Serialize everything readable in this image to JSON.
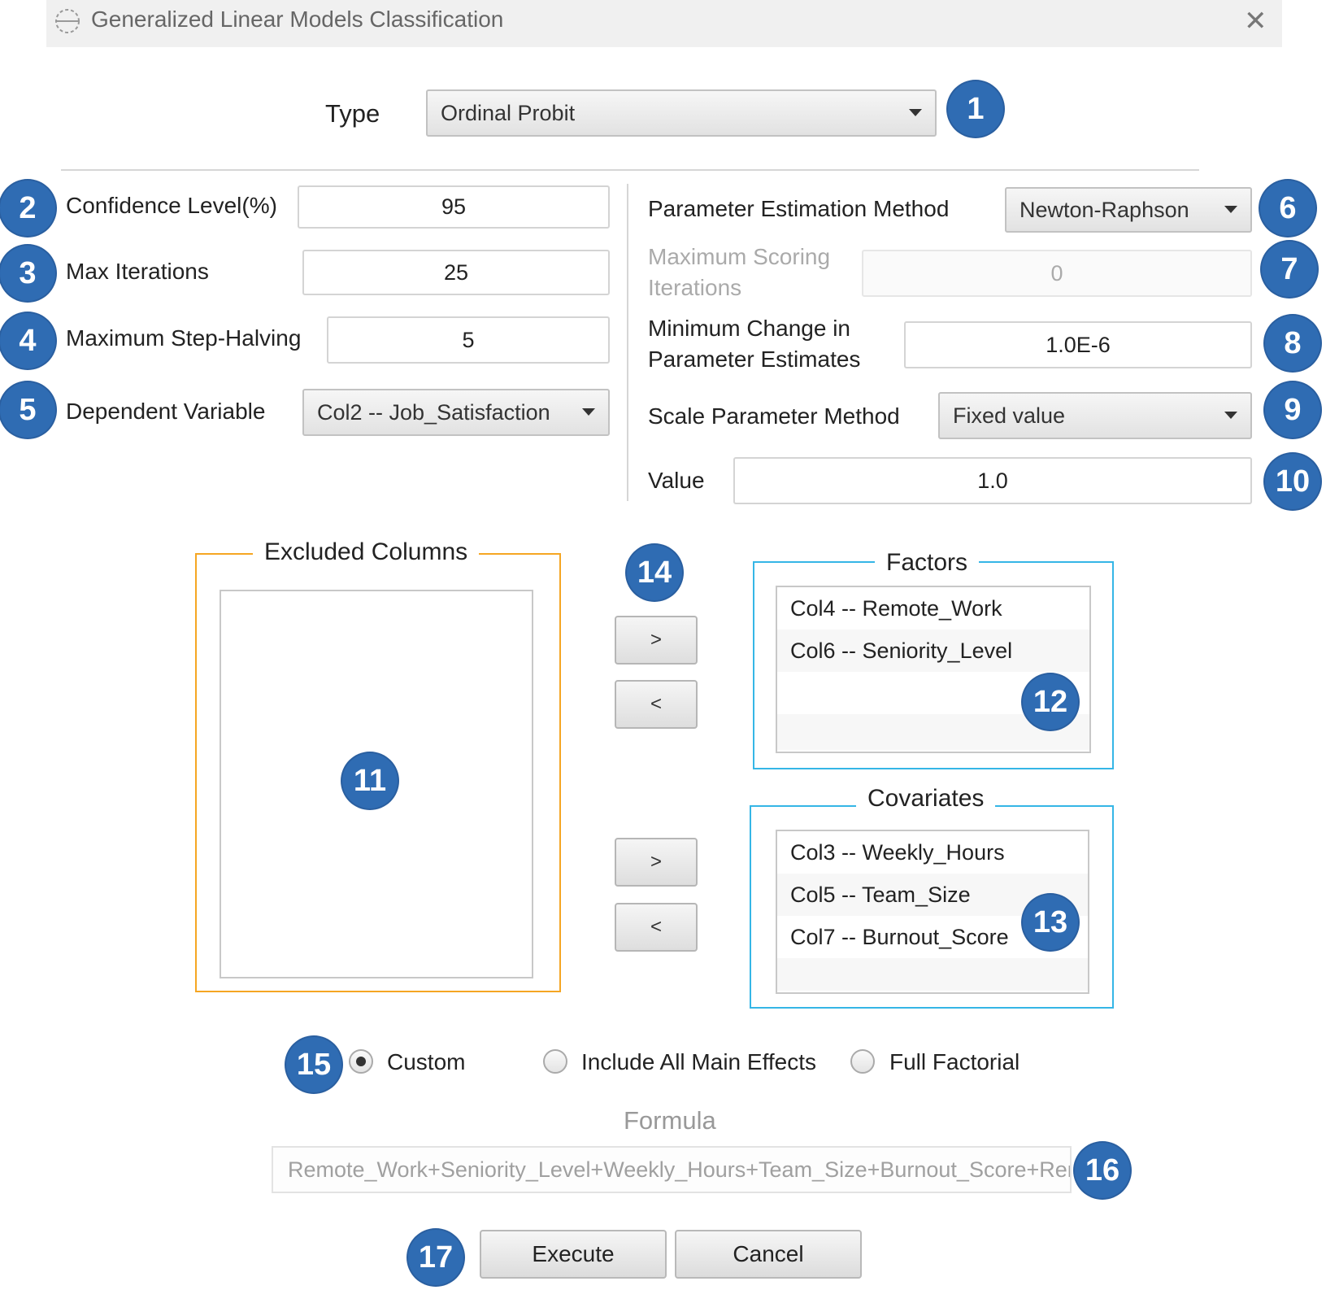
{
  "window": {
    "title": "Generalized Linear Models Classification",
    "app_icon": "app-icon",
    "close_icon": "close-icon"
  },
  "type": {
    "label": "Type",
    "value": "Ordinal Probit"
  },
  "left": {
    "confidence": {
      "label": "Confidence Level(%)",
      "value": "95"
    },
    "max_iterations": {
      "label": "Max Iterations",
      "value": "25"
    },
    "max_step_halving": {
      "label": "Maximum Step-Halving",
      "value": "5"
    },
    "dependent": {
      "label": "Dependent Variable",
      "value": "Col2 -- Job_Satisfaction"
    }
  },
  "right": {
    "estimation_method": {
      "label": "Parameter Estimation Method",
      "value": "Newton-Raphson"
    },
    "max_scoring": {
      "label_line1": "Maximum Scoring",
      "label_line2": "Iterations",
      "value": "0"
    },
    "min_change": {
      "label_line1": "Minimum Change in",
      "label_line2": "Parameter Estimates",
      "value": "1.0E-6"
    },
    "scale_method": {
      "label": "Scale Parameter Method",
      "value": "Fixed value"
    },
    "value": {
      "label": "Value",
      "value": "1.0"
    }
  },
  "excluded": {
    "title": "Excluded Columns",
    "items": []
  },
  "factors": {
    "title": "Factors",
    "items": [
      "Col4 -- Remote_Work",
      "Col6 -- Seniority_Level"
    ]
  },
  "covariates": {
    "title": "Covariates",
    "items": [
      "Col3 -- Weekly_Hours",
      "Col5 -- Team_Size",
      "Col7 -- Burnout_Score"
    ]
  },
  "move": {
    "right": ">",
    "left": "<"
  },
  "model": {
    "options": [
      "Custom",
      "Include All Main Effects",
      "Full Factorial"
    ],
    "selected": "Custom"
  },
  "formula": {
    "label": "Formula",
    "value": "Remote_Work+Seniority_Level+Weekly_Hours+Team_Size+Burnout_Score+Remote_Work*Seniority_Level"
  },
  "actions": {
    "execute": "Execute",
    "cancel": "Cancel"
  },
  "badges": [
    "1",
    "2",
    "3",
    "4",
    "5",
    "6",
    "7",
    "8",
    "9",
    "10",
    "11",
    "12",
    "13",
    "14",
    "15",
    "16",
    "17"
  ],
  "colors": {
    "badge": "#2f6cb3",
    "excluded_border": "#f5a623",
    "factors_border": "#35b6e6"
  }
}
